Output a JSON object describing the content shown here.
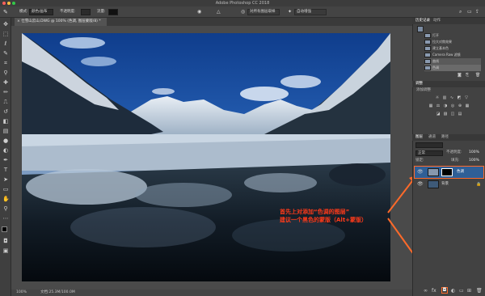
{
  "app": {
    "window_title": "Adobe Photoshop CC 2018"
  },
  "options_bar": {
    "mode_label": "模式:",
    "mode_value": "颜色/画布",
    "opacity_label": "不透明度:",
    "flow_label": "流量:",
    "sample_label": "对所有图层取样",
    "workspace_label": "自动增强"
  },
  "document": {
    "tab_title": "仕雪山云山.DWG @ 100% (色调, 图层蒙版/8) *",
    "zoom": "100%",
    "doc_size": "文档:25.3M/100.0M"
  },
  "history_panel": {
    "tab_active": "历史记录",
    "tab_other": "动作",
    "items": [
      "打开",
      "拉大对焦效果",
      "建立基本色",
      "Camera Raw 滤镜",
      "曲线",
      "色调"
    ]
  },
  "adjustments_panel": {
    "title": "调整",
    "subtitle": "添加调整"
  },
  "layers_panel": {
    "tabs": [
      "图层",
      "通道",
      "路径"
    ],
    "blend_mode": "正常",
    "opacity_label": "不透明度:",
    "opacity_value": "100%",
    "fill_label": "填充:",
    "fill_value": "100%",
    "lock_label": "锁定:",
    "layers": [
      {
        "name": "色调",
        "selected": true,
        "has_mask": true
      },
      {
        "name": "背景",
        "selected": false,
        "has_mask": false,
        "locked": true
      }
    ]
  },
  "annotation": {
    "line1": "首先上对添加“色调的图层”",
    "line2": "建议一个黑色的蒙版（Alt+蒙版）",
    "color": "#ff3a1a"
  },
  "colors": {
    "ui_bg": "#535353",
    "panel_bg": "#424242",
    "selected_layer": "#2f5f96",
    "accent_orange": "#ff6a2a"
  }
}
